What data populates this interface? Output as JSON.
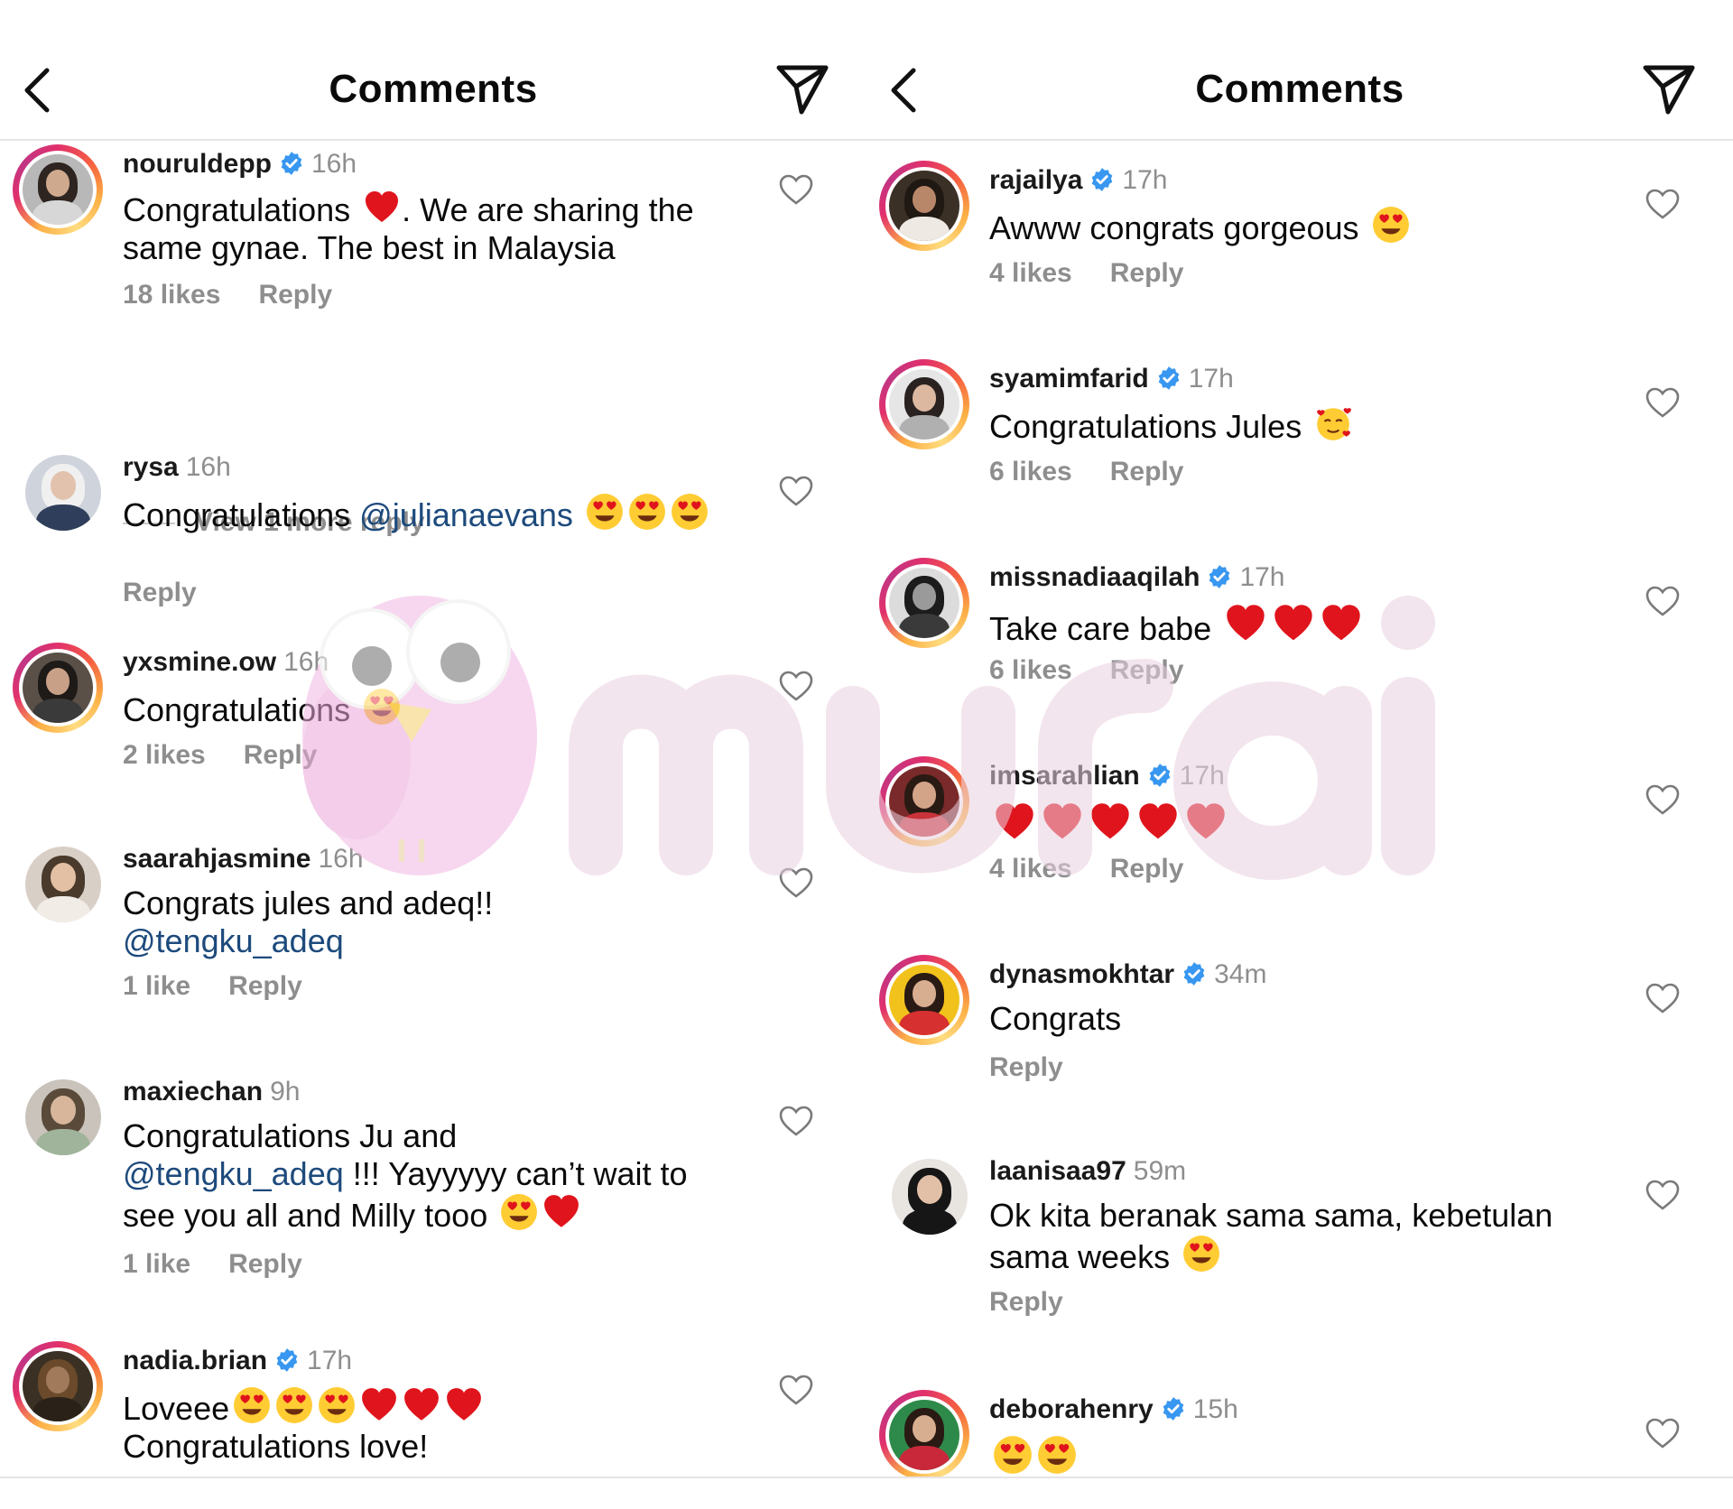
{
  "colors": {
    "story_ring": "#e1306c",
    "verified": "#3897f0",
    "mention": "#1d4a7c",
    "heart_emoji": "#e0141c",
    "muted_text": "#8e8e8e",
    "watermark_pink": "#f4c4e6"
  },
  "left": {
    "header": {
      "title": "Comments",
      "back_icon": "chevron-left-icon",
      "share_icon": "paper-plane-icon"
    },
    "comments": [
      {
        "username": "nouruldepp",
        "verified": true,
        "time": "16h",
        "text_a": "Congratulations ",
        "text_b": ". We are sharing the same gynae. The best in Malaysia",
        "likes": "18 likes",
        "reply": "Reply"
      },
      {
        "username": "rysa",
        "verified": false,
        "time": "16h",
        "text_a": "Congratulations ",
        "mention": "@julianaevans",
        "reply": "Reply"
      },
      {
        "username": "yxsmine.ow",
        "verified": false,
        "time": "16h",
        "text_a": "Congratulations",
        "likes": "2 likes",
        "reply": "Reply"
      },
      {
        "username": "saarahjasmine",
        "verified": false,
        "time": "16h",
        "text_a": "Congrats jules and adeq!!",
        "mention": "@tengku_adeq",
        "likes": "1 like",
        "reply": "Reply"
      },
      {
        "username": "maxiechan",
        "verified": false,
        "time": "9h",
        "text_a": "Congratulations Ju and ",
        "mention": "@tengku_adeq",
        "text_b": " !!! Yayyyyy can’t wait to see you all and Milly tooo",
        "likes": "1 like",
        "reply": "Reply"
      },
      {
        "username": "nadia.brian",
        "verified": true,
        "time": "17h",
        "text_a": "Loveee",
        "text_b": "Congratulations love!"
      }
    ],
    "view_more": "View 1 more reply"
  },
  "right": {
    "header": {
      "title": "Comments",
      "back_icon": "chevron-left-icon",
      "share_icon": "paper-plane-icon"
    },
    "comments": [
      {
        "username": "rajailya",
        "verified": true,
        "time": "17h",
        "text_a": "Awww congrats gorgeous ",
        "likes": "4 likes",
        "reply": "Reply"
      },
      {
        "username": "syamimfarid",
        "verified": true,
        "time": "17h",
        "text_a": "Congratulations Jules ",
        "likes": "6 likes",
        "reply": "Reply"
      },
      {
        "username": "missnadiaaqilah",
        "verified": true,
        "time": "17h",
        "text_a": "Take care babe ",
        "likes": "6 likes",
        "reply": "Reply"
      },
      {
        "username": "imsarahlian",
        "verified": true,
        "time": "17h",
        "likes": "4 likes",
        "reply": "Reply"
      },
      {
        "username": "dynasmokhtar",
        "verified": true,
        "time": "34m",
        "text_a": "Congrats",
        "reply": "Reply"
      },
      {
        "username": "laanisaa97",
        "verified": false,
        "time": "59m",
        "text_a": "Ok kita beranak sama sama, kebetulan sama weeks ",
        "reply": "Reply"
      },
      {
        "username": "deborahenry",
        "verified": true,
        "time": "15h"
      }
    ]
  }
}
